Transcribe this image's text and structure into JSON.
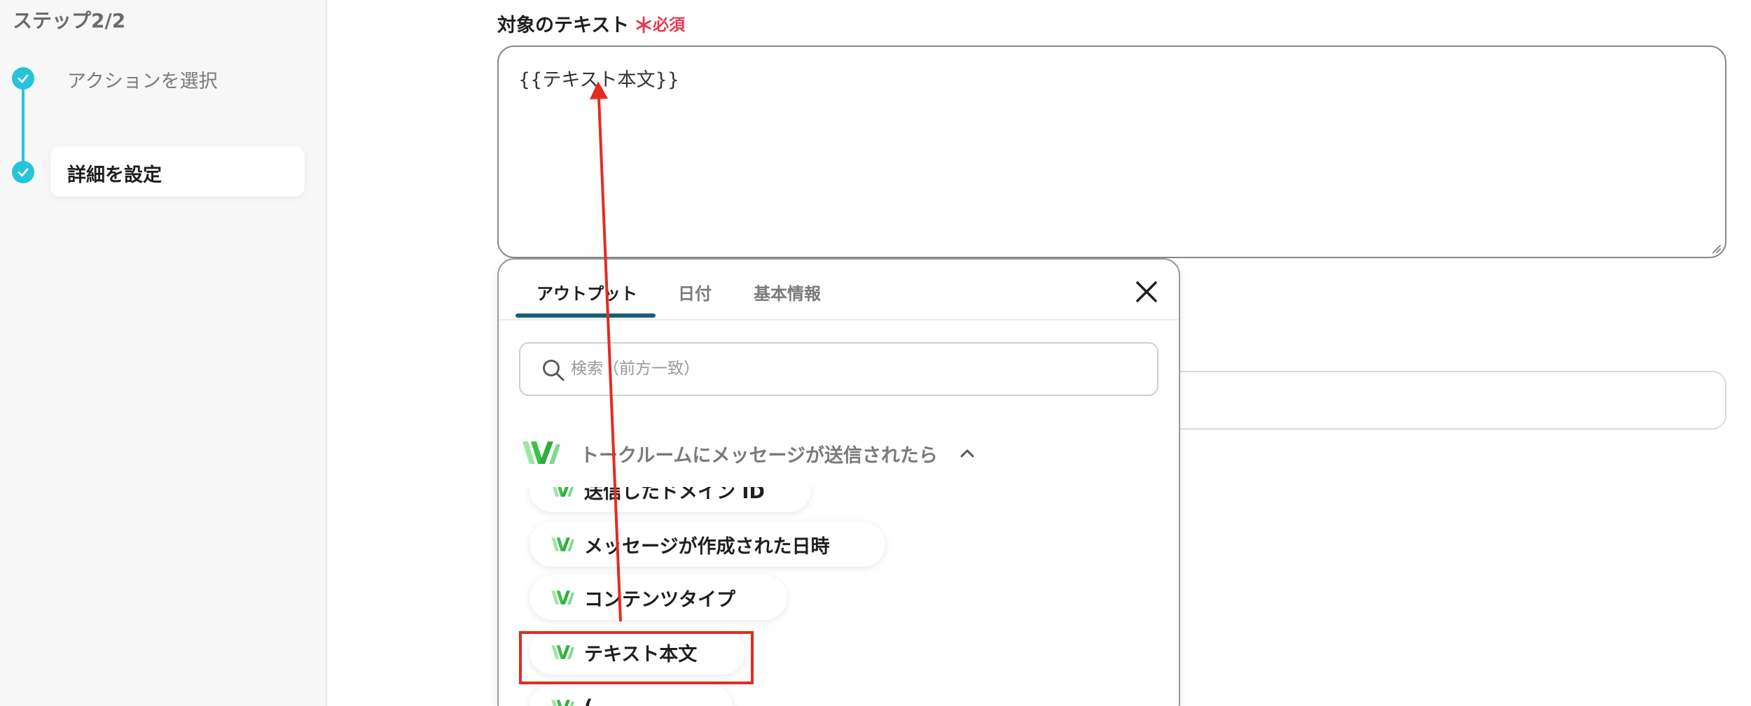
{
  "sidebar": {
    "step_header": "ステップ2/2",
    "steps": [
      {
        "label": "アクションを選択",
        "status": "done"
      },
      {
        "label": "詳細を設定",
        "status": "current"
      }
    ]
  },
  "field": {
    "label": "対象のテキスト",
    "required_star": "＊",
    "required_text": "必須",
    "value": "{{テキスト本文}}"
  },
  "popup": {
    "tabs": [
      {
        "label": "アウトプット",
        "active": true
      },
      {
        "label": "日付",
        "active": false
      },
      {
        "label": "基本情報",
        "active": false
      }
    ],
    "search_placeholder": "検索（前方一致）",
    "group_title": "トークルームにメッセージが送信されたら",
    "items": [
      {
        "label": "送信したドメイン ID"
      },
      {
        "label": "メッセージが作成された日時"
      },
      {
        "label": "コンテンツタイプ"
      },
      {
        "label": "テキスト本文",
        "highlighted": true
      },
      {
        "label": "("
      }
    ]
  },
  "colors": {
    "accent_teal": "#25c4d8",
    "tab_underline": "#1d5f7a",
    "required_red": "#e8384f",
    "annotation_red": "#e52b21",
    "logo_green": "#3dbf4a"
  }
}
